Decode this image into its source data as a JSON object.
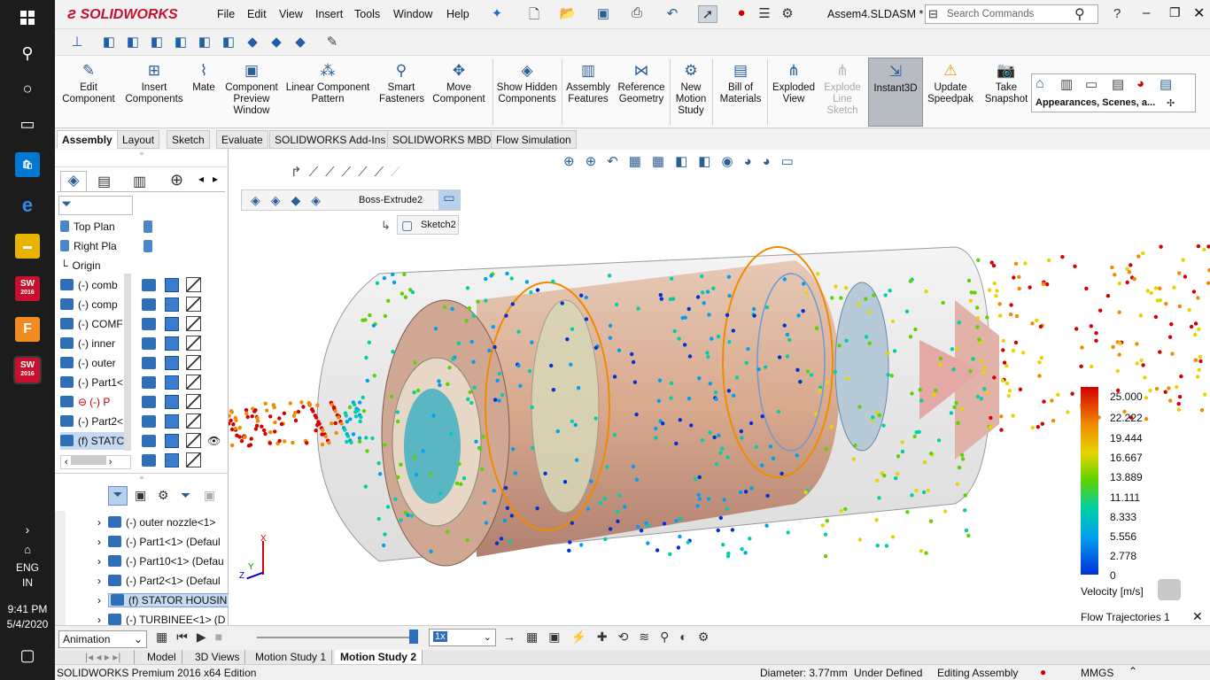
{
  "taskbar": {
    "lang": "ENG",
    "region": "IN",
    "time": "9:41 PM",
    "date": "5/4/2020",
    "sw_badge": "SW",
    "sw_year": "2016",
    "f_badge": "F"
  },
  "titlebar": {
    "brand": "SOLIDWORKS",
    "menus": [
      "File",
      "Edit",
      "View",
      "Insert",
      "Tools",
      "Window",
      "Help"
    ],
    "doc_title": "Assem4.SLDASM *",
    "search_placeholder": "Search Commands",
    "help": "?"
  },
  "ribbon": {
    "buttons": [
      "Edit Component",
      "Insert Components",
      "Mate",
      "Component Preview Window",
      "Linear Component Pattern",
      "Smart Fasteners",
      "Move Component",
      "Show Hidden Components",
      "Assembly Features",
      "Reference Geometry",
      "New Motion Study",
      "Bill of Materials",
      "Exploded View",
      "Explode Line Sketch",
      "Instant3D",
      "Update Speedpak",
      "Take Snapshot"
    ],
    "appearances": "Appearances, Scenes, a..."
  },
  "command_tabs": [
    "Assembly",
    "Layout",
    "Sketch",
    "Evaluate",
    "SOLIDWORKS Add-Ins",
    "SOLIDWORKS MBD",
    "Flow Simulation"
  ],
  "feature_tree": [
    "Top Plan",
    "Right Pla",
    "Origin",
    "(-) comb",
    "(-) comp",
    "(-) COMF",
    "(-) inner",
    "(-) outer",
    "(-) Part1<",
    "(-) P",
    "(-) Part2<",
    "(f) STATC"
  ],
  "breadcrumb": {
    "feature": "Boss-Extrude2",
    "sketch": "Sketch2"
  },
  "lower_tree": [
    "(-) outer nozzle<1>",
    "(-) Part1<1> (Defaul",
    "(-) Part10<1> (Defau",
    "(-) Part2<1> (Defaul",
    "(f) STATOR HOUSIN",
    "(-) TURBINEE<1> (D"
  ],
  "legend": {
    "values": [
      "25.000",
      "22.222",
      "19.444",
      "16.667",
      "13.889",
      "11.111",
      "8.333",
      "5.556",
      "2.778",
      "0"
    ],
    "title": "Velocity [m/s]",
    "plot": "Flow Trajectories 1",
    "colors": [
      "#d40000",
      "#f08a00",
      "#e8d400",
      "#5bd300",
      "#00cfa8",
      "#00a0f0",
      "#0030d8"
    ]
  },
  "triad": {
    "x": "X",
    "y": "Y",
    "z": "Z"
  },
  "motion": {
    "mode": "Animation",
    "speed": "1x"
  },
  "bottom_tabs": [
    "Model",
    "3D Views",
    "Motion Study 1",
    "Motion Study 2"
  ],
  "status": {
    "product": "SOLIDWORKS Premium 2016 x64 Edition",
    "diameter": "Diameter: 3.77mm",
    "defined": "Under Defined",
    "editing": "Editing Assembly",
    "units": "MMGS"
  }
}
